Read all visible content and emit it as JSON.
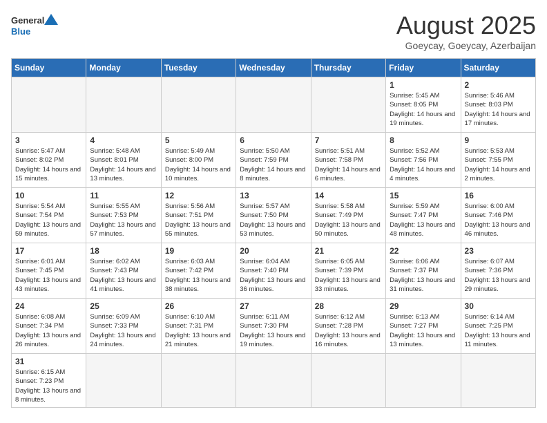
{
  "logo": {
    "general": "General",
    "blue": "Blue"
  },
  "title": "August 2025",
  "subtitle": "Goeycay, Goeycay, Azerbaijan",
  "weekdays": [
    "Sunday",
    "Monday",
    "Tuesday",
    "Wednesday",
    "Thursday",
    "Friday",
    "Saturday"
  ],
  "weeks": [
    [
      {
        "day": "",
        "info": ""
      },
      {
        "day": "",
        "info": ""
      },
      {
        "day": "",
        "info": ""
      },
      {
        "day": "",
        "info": ""
      },
      {
        "day": "",
        "info": ""
      },
      {
        "day": "1",
        "info": "Sunrise: 5:45 AM\nSunset: 8:05 PM\nDaylight: 14 hours\nand 19 minutes."
      },
      {
        "day": "2",
        "info": "Sunrise: 5:46 AM\nSunset: 8:03 PM\nDaylight: 14 hours\nand 17 minutes."
      }
    ],
    [
      {
        "day": "3",
        "info": "Sunrise: 5:47 AM\nSunset: 8:02 PM\nDaylight: 14 hours\nand 15 minutes."
      },
      {
        "day": "4",
        "info": "Sunrise: 5:48 AM\nSunset: 8:01 PM\nDaylight: 14 hours\nand 13 minutes."
      },
      {
        "day": "5",
        "info": "Sunrise: 5:49 AM\nSunset: 8:00 PM\nDaylight: 14 hours\nand 10 minutes."
      },
      {
        "day": "6",
        "info": "Sunrise: 5:50 AM\nSunset: 7:59 PM\nDaylight: 14 hours\nand 8 minutes."
      },
      {
        "day": "7",
        "info": "Sunrise: 5:51 AM\nSunset: 7:58 PM\nDaylight: 14 hours\nand 6 minutes."
      },
      {
        "day": "8",
        "info": "Sunrise: 5:52 AM\nSunset: 7:56 PM\nDaylight: 14 hours\nand 4 minutes."
      },
      {
        "day": "9",
        "info": "Sunrise: 5:53 AM\nSunset: 7:55 PM\nDaylight: 14 hours\nand 2 minutes."
      }
    ],
    [
      {
        "day": "10",
        "info": "Sunrise: 5:54 AM\nSunset: 7:54 PM\nDaylight: 13 hours\nand 59 minutes."
      },
      {
        "day": "11",
        "info": "Sunrise: 5:55 AM\nSunset: 7:53 PM\nDaylight: 13 hours\nand 57 minutes."
      },
      {
        "day": "12",
        "info": "Sunrise: 5:56 AM\nSunset: 7:51 PM\nDaylight: 13 hours\nand 55 minutes."
      },
      {
        "day": "13",
        "info": "Sunrise: 5:57 AM\nSunset: 7:50 PM\nDaylight: 13 hours\nand 53 minutes."
      },
      {
        "day": "14",
        "info": "Sunrise: 5:58 AM\nSunset: 7:49 PM\nDaylight: 13 hours\nand 50 minutes."
      },
      {
        "day": "15",
        "info": "Sunrise: 5:59 AM\nSunset: 7:47 PM\nDaylight: 13 hours\nand 48 minutes."
      },
      {
        "day": "16",
        "info": "Sunrise: 6:00 AM\nSunset: 7:46 PM\nDaylight: 13 hours\nand 46 minutes."
      }
    ],
    [
      {
        "day": "17",
        "info": "Sunrise: 6:01 AM\nSunset: 7:45 PM\nDaylight: 13 hours\nand 43 minutes."
      },
      {
        "day": "18",
        "info": "Sunrise: 6:02 AM\nSunset: 7:43 PM\nDaylight: 13 hours\nand 41 minutes."
      },
      {
        "day": "19",
        "info": "Sunrise: 6:03 AM\nSunset: 7:42 PM\nDaylight: 13 hours\nand 38 minutes."
      },
      {
        "day": "20",
        "info": "Sunrise: 6:04 AM\nSunset: 7:40 PM\nDaylight: 13 hours\nand 36 minutes."
      },
      {
        "day": "21",
        "info": "Sunrise: 6:05 AM\nSunset: 7:39 PM\nDaylight: 13 hours\nand 33 minutes."
      },
      {
        "day": "22",
        "info": "Sunrise: 6:06 AM\nSunset: 7:37 PM\nDaylight: 13 hours\nand 31 minutes."
      },
      {
        "day": "23",
        "info": "Sunrise: 6:07 AM\nSunset: 7:36 PM\nDaylight: 13 hours\nand 29 minutes."
      }
    ],
    [
      {
        "day": "24",
        "info": "Sunrise: 6:08 AM\nSunset: 7:34 PM\nDaylight: 13 hours\nand 26 minutes."
      },
      {
        "day": "25",
        "info": "Sunrise: 6:09 AM\nSunset: 7:33 PM\nDaylight: 13 hours\nand 24 minutes."
      },
      {
        "day": "26",
        "info": "Sunrise: 6:10 AM\nSunset: 7:31 PM\nDaylight: 13 hours\nand 21 minutes."
      },
      {
        "day": "27",
        "info": "Sunrise: 6:11 AM\nSunset: 7:30 PM\nDaylight: 13 hours\nand 19 minutes."
      },
      {
        "day": "28",
        "info": "Sunrise: 6:12 AM\nSunset: 7:28 PM\nDaylight: 13 hours\nand 16 minutes."
      },
      {
        "day": "29",
        "info": "Sunrise: 6:13 AM\nSunset: 7:27 PM\nDaylight: 13 hours\nand 13 minutes."
      },
      {
        "day": "30",
        "info": "Sunrise: 6:14 AM\nSunset: 7:25 PM\nDaylight: 13 hours\nand 11 minutes."
      }
    ],
    [
      {
        "day": "31",
        "info": "Sunrise: 6:15 AM\nSunset: 7:23 PM\nDaylight: 13 hours\nand 8 minutes."
      },
      {
        "day": "",
        "info": ""
      },
      {
        "day": "",
        "info": ""
      },
      {
        "day": "",
        "info": ""
      },
      {
        "day": "",
        "info": ""
      },
      {
        "day": "",
        "info": ""
      },
      {
        "day": "",
        "info": ""
      }
    ]
  ]
}
